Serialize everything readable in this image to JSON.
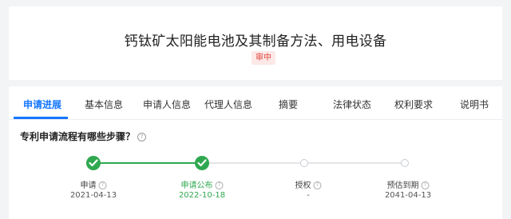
{
  "header": {
    "title": "钙钛矿太阳能电池及其制备方法、用电设备",
    "status_badge": "审中"
  },
  "tabs": [
    {
      "label": "申请进展",
      "active": true
    },
    {
      "label": "基本信息",
      "active": false
    },
    {
      "label": "申请人信息",
      "active": false
    },
    {
      "label": "代理人信息",
      "active": false
    },
    {
      "label": "摘要",
      "active": false
    },
    {
      "label": "法律状态",
      "active": false
    },
    {
      "label": "权利要求",
      "active": false
    },
    {
      "label": "说明书",
      "active": false
    }
  ],
  "progress": {
    "question": "专利申请流程有哪些步骤？",
    "steps": [
      {
        "label": "申请",
        "date": "2021-04-13",
        "done": true
      },
      {
        "label": "申请公布",
        "date": "2022-10-18",
        "done": true
      },
      {
        "label": "授权",
        "date": "-",
        "done": false
      },
      {
        "label": "预估到期",
        "date": "2041-04-13",
        "done": false
      }
    ]
  },
  "colors": {
    "accent": "#1677ff",
    "done": "#2fa84f",
    "badge_bg": "#fde8e8",
    "badge_text": "#e0453a"
  }
}
